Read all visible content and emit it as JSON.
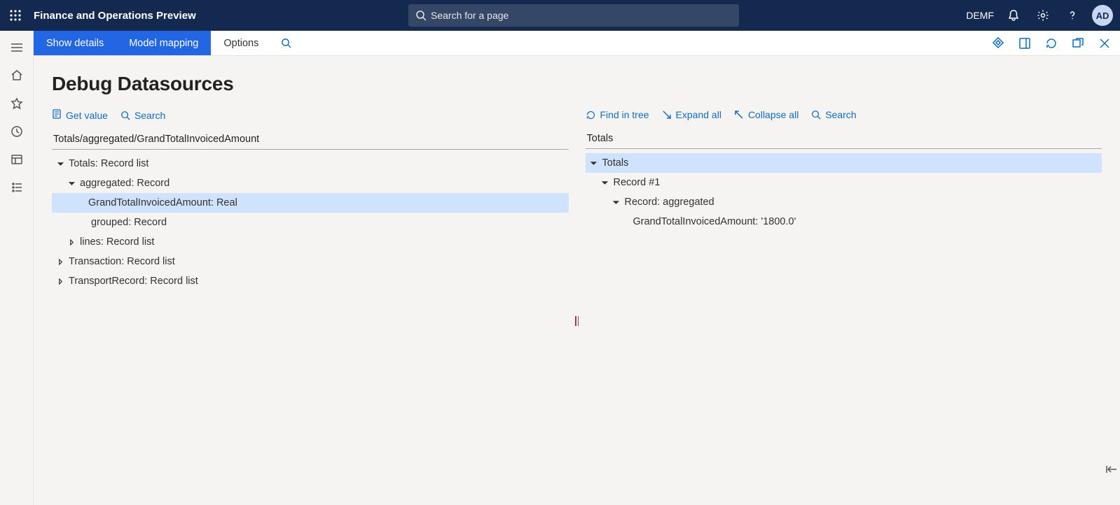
{
  "topbar": {
    "app_title": "Finance and Operations Preview",
    "search_placeholder": "Search for a page",
    "company": "DEMF",
    "avatar": "AD"
  },
  "actionbar": {
    "show_details": "Show details",
    "model_mapping": "Model mapping",
    "options": "Options"
  },
  "page": {
    "title": "Debug Datasources"
  },
  "left_toolbar": {
    "get_value": "Get value",
    "search": "Search"
  },
  "left_pane": {
    "path": "Totals/aggregated/GrandTotalInvoicedAmount",
    "tree": {
      "n0": "Totals: Record list",
      "n1": "aggregated: Record",
      "n2": "GrandTotalInvoicedAmount: Real",
      "n3": "grouped: Record",
      "n4": "lines: Record list",
      "n5": "Transaction: Record list",
      "n6": "TransportRecord: Record list"
    }
  },
  "right_toolbar": {
    "find_in_tree": "Find in tree",
    "expand_all": "Expand all",
    "collapse_all": "Collapse all",
    "search": "Search"
  },
  "right_pane": {
    "path": "Totals",
    "tree": {
      "n0": "Totals",
      "n1": "Record #1",
      "n2": "Record: aggregated",
      "n3": "GrandTotalInvoicedAmount: '1800.0'"
    }
  }
}
